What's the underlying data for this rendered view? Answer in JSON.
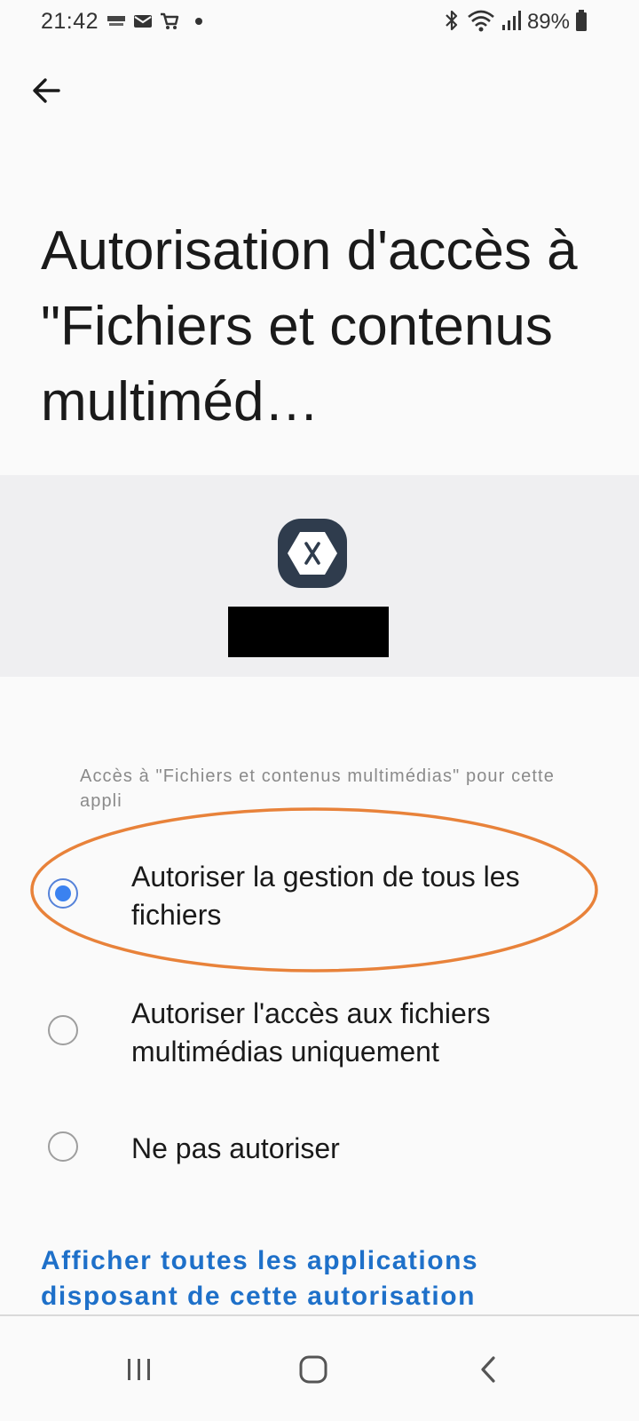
{
  "status_bar": {
    "time": "21:42",
    "battery": "89%",
    "notification_icons": [
      "news-app-icon",
      "mail-icon",
      "cart-icon",
      "dot-icon"
    ],
    "system_icons": [
      "bluetooth-icon",
      "wifi-icon",
      "signal-icon",
      "battery-icon"
    ]
  },
  "header": {
    "back_icon": "arrow-left-icon",
    "title": "Autorisation d'accès à \"Fichiers et contenus multiméd…"
  },
  "app": {
    "icon": "xamarin-logo-icon",
    "icon_color": "#2f3c4d",
    "name_redacted": true
  },
  "permission": {
    "subheader": "Accès à \"Fichiers et contenus multimédias\" pour cette appli",
    "options": [
      {
        "label": "Autoriser la gestion de tous les fichiers",
        "selected": true
      },
      {
        "label": "Autoriser l'accès aux fichiers multimédias uniquement",
        "selected": false
      },
      {
        "label": "Ne pas autoriser",
        "selected": false
      }
    ],
    "highlight_color": "#e8823a"
  },
  "link": {
    "label": "Afficher toutes les applications disposant de cette autorisation",
    "color": "#1e70c9"
  },
  "nav_bar": {
    "buttons": [
      "recents-icon",
      "home-icon",
      "back-icon"
    ]
  }
}
